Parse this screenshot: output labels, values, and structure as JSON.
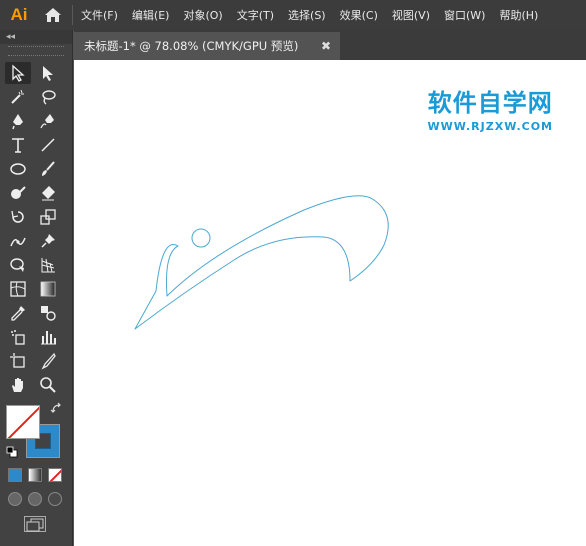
{
  "app": {
    "logo": "Ai"
  },
  "menu": {
    "items": [
      "文件(F)",
      "编辑(E)",
      "对象(O)",
      "文字(T)",
      "选择(S)",
      "效果(C)",
      "视图(V)",
      "窗口(W)",
      "帮助(H)"
    ]
  },
  "tabs": [
    {
      "title": "未标题-1* @ 78.08% (CMYK/GPU 预览)",
      "close": "✖"
    }
  ],
  "toolpanel": {
    "collapse": "◂◂"
  },
  "watermark": {
    "title": "软件自学网",
    "url": "WWW.RJZXW.COM"
  },
  "colors": {
    "accent": "#1a9ad7",
    "stroke_path": "#4aa8d0",
    "stroke_swatch": "#2d89c8",
    "logo": "#ff9a00"
  },
  "tools": [
    "selection-tool",
    "direct-selection-tool",
    "magic-wand-tool",
    "lasso-tool",
    "pen-tool",
    "curvature-tool",
    "type-tool",
    "line-segment-tool",
    "ellipse-tool",
    "paintbrush-tool",
    "blob-brush-tool",
    "eraser-tool",
    "rotate-tool",
    "scale-tool",
    "puppet-warp-tool",
    "pin-tool",
    "shape-builder-tool",
    "perspective-grid-tool",
    "mesh-tool",
    "gradient-tool",
    "eyedropper-tool",
    "blend-tool",
    "symbol-sprayer-tool",
    "column-graph-tool",
    "artboard-tool",
    "slice-tool",
    "hand-tool",
    "zoom-tool"
  ]
}
